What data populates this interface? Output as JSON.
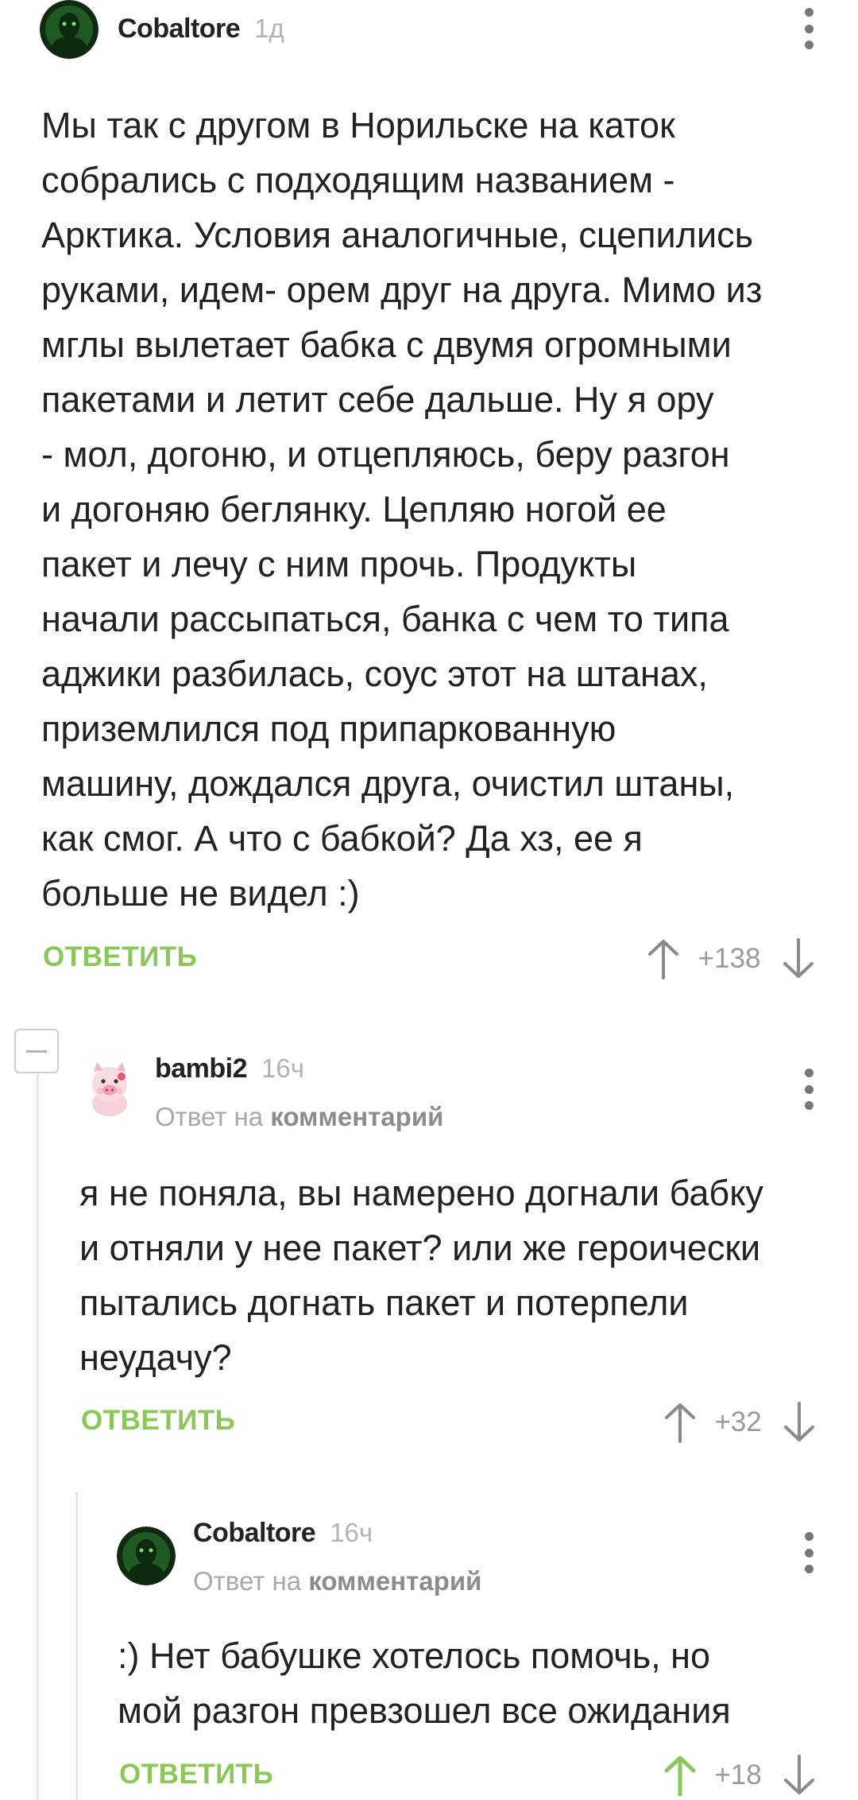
{
  "comments": [
    {
      "author": "Cobaltore",
      "time": "1д",
      "text": "Мы так с другом в Норильске на каток\nсобрались с подходящим названием -\nАрктика. Условия аналогичные, сцепились\nруками, идем- орем друг на друга. Мимо из\nмглы вылетает бабка с двумя огромными\nпакетами и летит себе дальше. Ну я ору\n- мол, догоню, и отцепляюсь, беру разгон\nи догоняю беглянку. Цепляю ногой ее\nпакет и лечу с ним прочь. Продукты\nначали рассыпаться, банка с чем то типа\nаджики разбилась, соус этот на штанах,\nприземлился под припаркованную\nмашину, дождался друга, очистил штаны,\nкак смог. А что с бабкой? Да хз, ее я\nбольше не видел :)",
      "reply_label": "ОТВЕТИТЬ",
      "score": "+138",
      "vote_state": "none"
    },
    {
      "author": "bambi2",
      "time": "16ч",
      "reply_prefix": "Ответ на",
      "reply_link": "комментарий",
      "text": "я не поняла, вы намерено догнали бабку\nи отняли у нее пакет? или же героически\nпытались догнать пакет и потерпели\nнеудачу?",
      "reply_label": "ОТВЕТИТЬ",
      "score": "+32",
      "vote_state": "none"
    },
    {
      "author": "Cobaltore",
      "time": "16ч",
      "reply_prefix": "Ответ на",
      "reply_link": "комментарий",
      "text": ":) Нет бабушке хотелось помочь, но\nмой разгон превзошел все ожидания",
      "reply_label": "ОТВЕТИТЬ",
      "score": "+18",
      "vote_state": "up"
    }
  ],
  "colors": {
    "accent_green": "#8ac858",
    "upvoted_green": "#8ac858",
    "arrow_gray": "#8a8a8a",
    "text": "#222222",
    "muted": "#b3b3b3"
  },
  "icons": {
    "menu": "more-vertical-icon",
    "upvote": "arrow-up-icon",
    "downvote": "arrow-down-icon",
    "collapse": "minus-square-icon"
  }
}
